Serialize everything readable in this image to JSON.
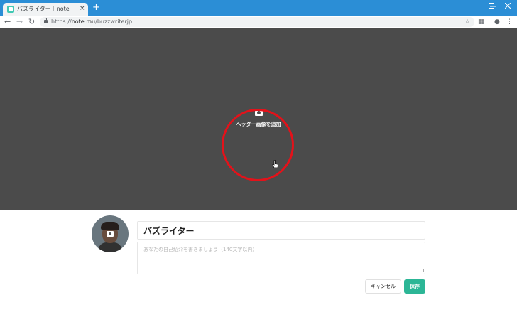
{
  "browser": {
    "tab_title": "バズライター｜note",
    "tab_close": "×",
    "new_tab": "+",
    "url_prefix": "https://",
    "url_host": "note.mu",
    "url_path": "/buzzwriterjp",
    "icons": {
      "favicon": "note-favicon-icon",
      "back": "arrow-left-icon",
      "forward": "arrow-right-icon",
      "reload": "reload-icon",
      "lock": "lock-icon",
      "bookmark": "star-icon",
      "extension": "extension-icon",
      "profile": "account-icon",
      "menu": "kebab-menu-icon"
    }
  },
  "header": {
    "add_image_label": "ヘッダー画像を追加",
    "camera_icon": "camera-icon",
    "highlight_color": "#e3121a",
    "background_color": "#4b4b4b"
  },
  "profile": {
    "avatar_icon": "avatar-image",
    "avatar_camera_icon": "camera-icon",
    "name_value": "バズライター",
    "bio_placeholder": "あなたの自己紹介を書きましょう（140文字以内）",
    "bio_value": ""
  },
  "actions": {
    "cancel_label": "キャンセル",
    "save_label": "保存",
    "save_color": "#2cb696"
  }
}
